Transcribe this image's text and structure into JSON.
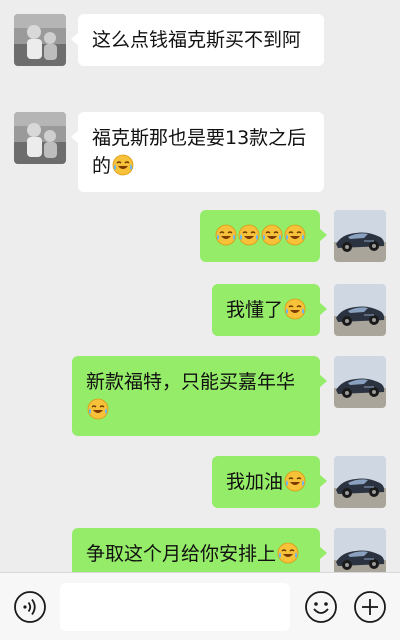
{
  "colors": {
    "background": "#ededed",
    "incoming_bubble": "#ffffff",
    "outgoing_bubble": "#95ec69",
    "composer_bg": "#f7f7f7"
  },
  "messages": [
    {
      "side": "in",
      "text": "这么点钱福克斯买不到阿",
      "emoji_count": 0
    },
    {
      "side": "in",
      "text": "福克斯那也是要13款之后的",
      "emoji_count": 1,
      "emoji": "laughing-tears"
    },
    {
      "side": "out",
      "text": "",
      "emoji_count": 4,
      "emoji": "laughing-tears"
    },
    {
      "side": "out",
      "text": "我懂了",
      "emoji_count": 1,
      "emoji": "laughing-tears"
    },
    {
      "side": "out",
      "text": "新款福特，只能买嘉年华",
      "emoji_count": 1,
      "emoji": "laughing-tears"
    },
    {
      "side": "out",
      "text": "我加油",
      "emoji_count": 1,
      "emoji": "laughing-tears"
    },
    {
      "side": "out",
      "text": "争取这个月给你安排上",
      "emoji_count": 1,
      "emoji": "laughing-tears"
    }
  ],
  "composer": {
    "voice_icon": "voice-icon",
    "input_value": "",
    "emoji_icon": "emoji-icon",
    "plus_icon": "plus-icon"
  }
}
